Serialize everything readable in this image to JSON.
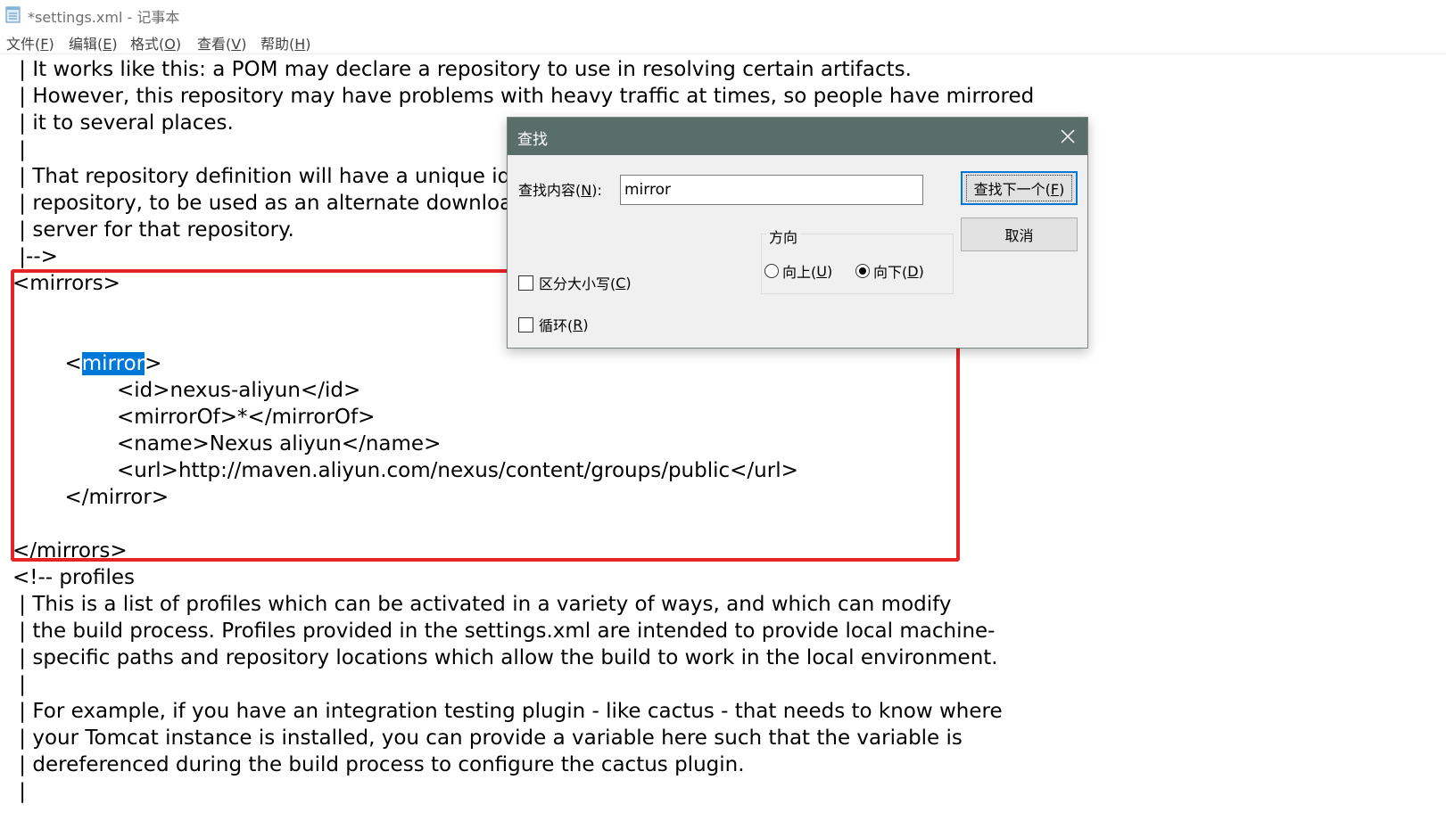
{
  "window": {
    "title": "*settings.xml - 记事本",
    "icon": "notepad-icon"
  },
  "menu": [
    {
      "label": "文件(",
      "mnemonic": "F",
      "suffix": ")"
    },
    {
      "label": "编辑(",
      "mnemonic": "E",
      "suffix": ")"
    },
    {
      "label": "格式(",
      "mnemonic": "O",
      "suffix": ")"
    },
    {
      "label": "查看(",
      "mnemonic": "V",
      "suffix": ")"
    },
    {
      "label": "帮助(",
      "mnemonic": "H",
      "suffix": ")"
    }
  ],
  "editor": {
    "lines": [
      " | It works like this: a POM may declare a repository to use in resolving certain artifacts.",
      " | However, this repository may have problems with heavy traffic at times, so people have mirrored",
      " | it to several places.",
      " |",
      " | That repository definition will have a unique id, s",
      " | repository, to be used as an alternate download",
      " | server for that repository.",
      " |-->",
      "<mirrors>",
      "",
      "",
      "",
      "                <id>nexus-aliyun</id>",
      "                <mirrorOf>*</mirrorOf>",
      "                <name>Nexus aliyun</name>",
      "                <url>http://maven.aliyun.com/nexus/content/groups/public</url>",
      "        </mirror>",
      "",
      "</mirrors>",
      "<!-- profiles",
      " | This is a list of profiles which can be activated in a variety of ways, and which can modify",
      " | the build process. Profiles provided in the settings.xml are intended to provide local machine-",
      " | specific paths and repository locations which allow the build to work in the local environment.",
      " |",
      " | For example, if you have an integration testing plugin - like cactus - that needs to know where",
      " | your Tomcat instance is installed, you can provide a variable here such that the variable is",
      " | dereferenced during the build process to configure the cactus plugin.",
      " |"
    ],
    "mirror_line": {
      "before": "        <",
      "selected": "mirror",
      "after": ">"
    },
    "selection_color": "#0078d7",
    "annotation_color": "#e52424"
  },
  "find_dialog": {
    "title": "查找",
    "find_label": "查找内容(",
    "find_mnemonic": "N",
    "find_suffix": "):",
    "find_value": "mirror",
    "find_next_label": "查找下一个(",
    "find_next_mnemonic": "F",
    "find_next_suffix": ")",
    "cancel_label": "取消",
    "direction_label": "方向",
    "up_label": "向上(",
    "up_mnemonic": "U",
    "up_suffix": ")",
    "down_label": "向下(",
    "down_mnemonic": "D",
    "down_suffix": ")",
    "direction_selected": "down",
    "match_case_label": "区分大小写(",
    "match_case_mnemonic": "C",
    "match_case_suffix": ")",
    "match_case_checked": false,
    "wrap_label": "循环(",
    "wrap_mnemonic": "R",
    "wrap_suffix": ")",
    "wrap_checked": false,
    "titlebar_color": "#5a6e69"
  }
}
